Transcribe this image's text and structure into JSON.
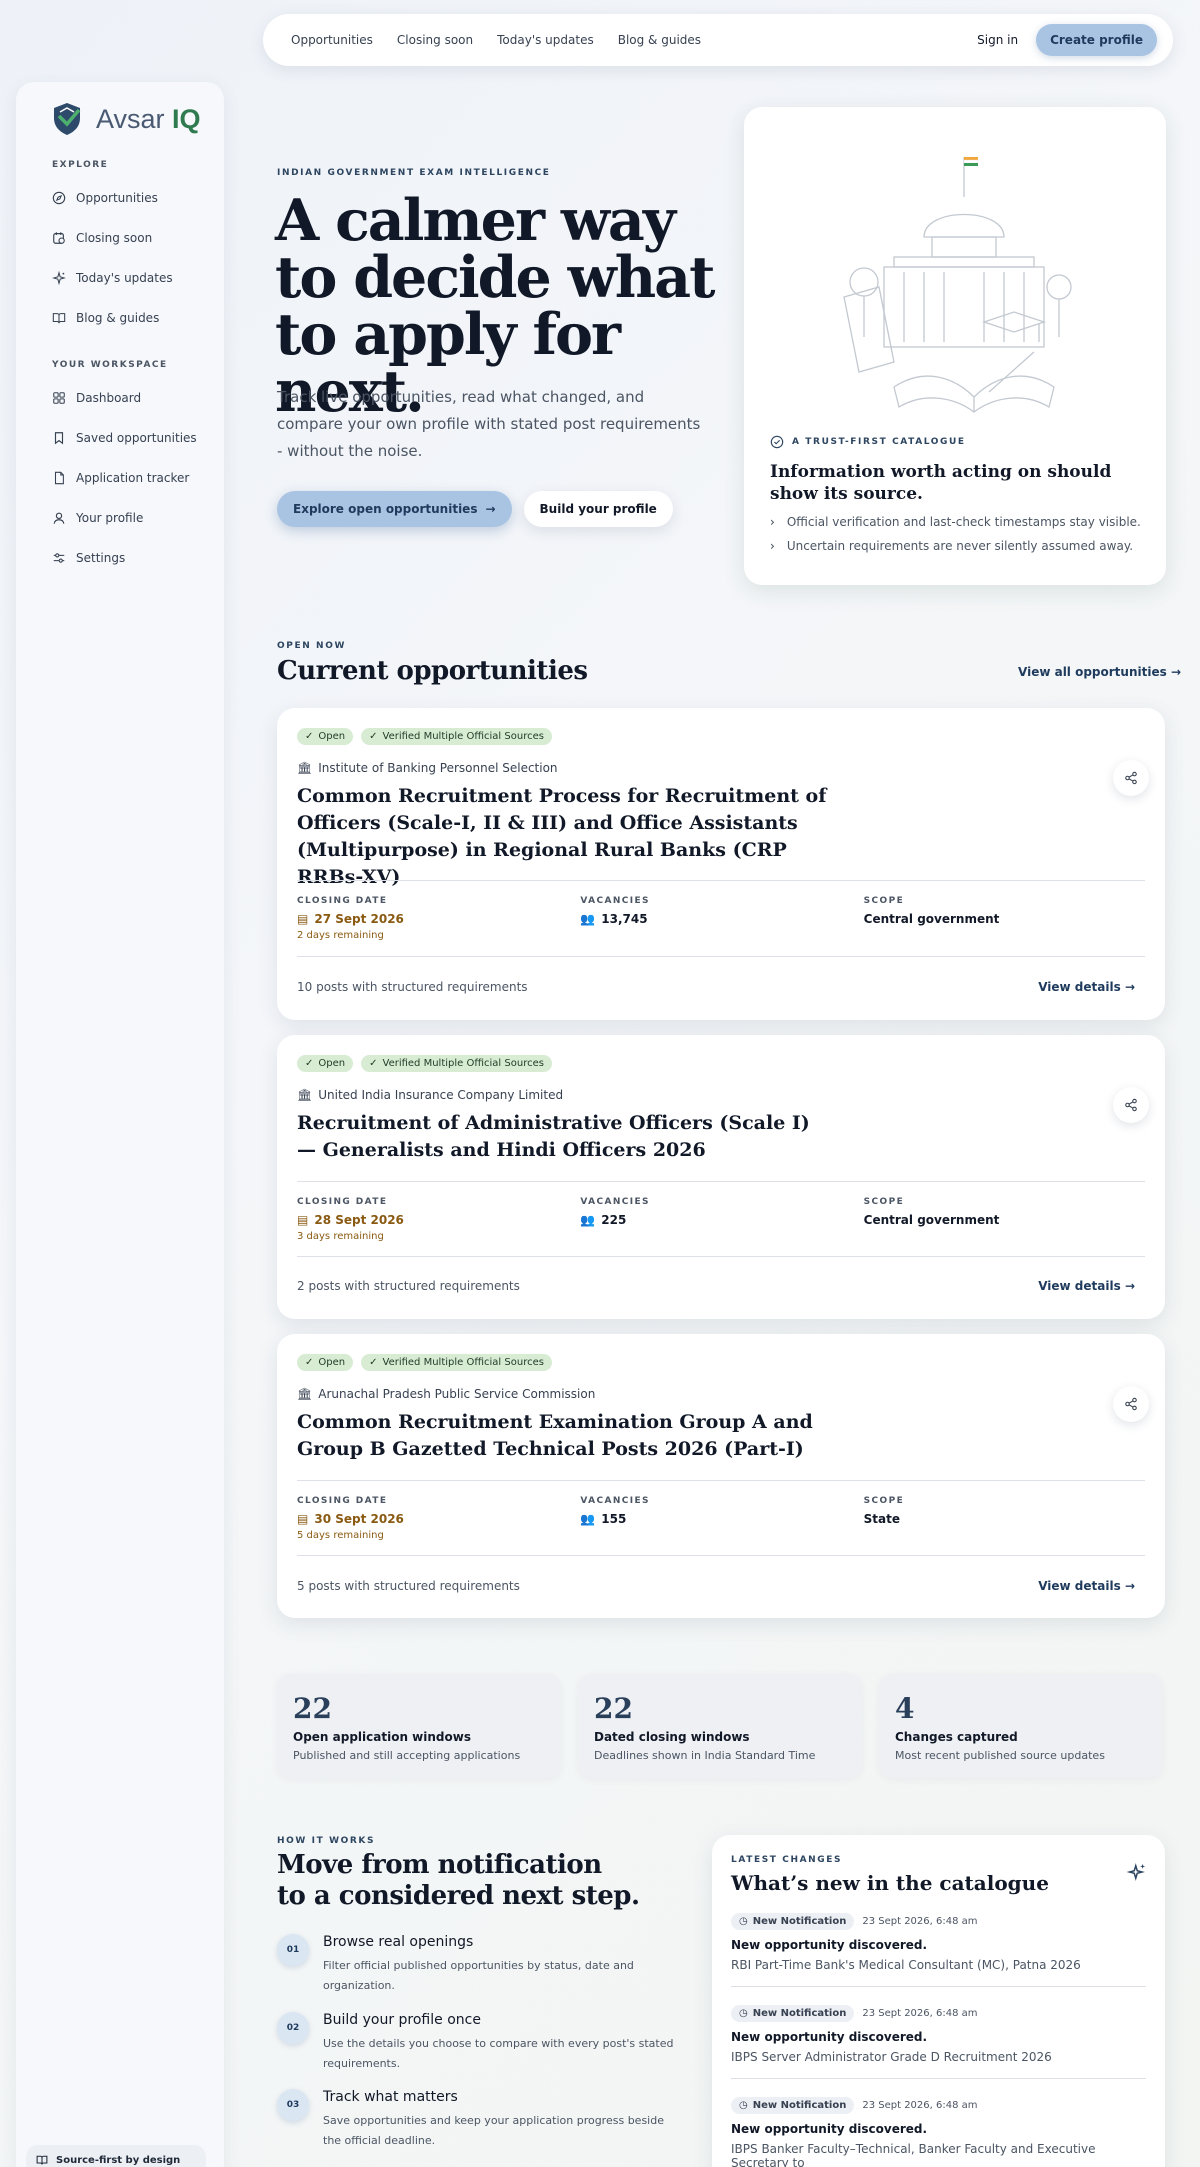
{
  "topnav": {
    "links": [
      "Opportunities",
      "Closing soon",
      "Today's updates",
      "Blog & guides"
    ],
    "sign_in": "Sign in",
    "create_profile": "Create profile"
  },
  "brand": {
    "name_main": "Avsar",
    "name_accent": "IQ"
  },
  "sidebar": {
    "explore_label": "EXPLORE",
    "explore": [
      {
        "label": "Opportunities",
        "icon": "compass-icon"
      },
      {
        "label": "Closing soon",
        "icon": "calendar-clock-icon"
      },
      {
        "label": "Today's updates",
        "icon": "sparkles-icon"
      },
      {
        "label": "Blog & guides",
        "icon": "book-icon"
      }
    ],
    "workspace_label": "YOUR WORKSPACE",
    "workspace": [
      {
        "label": "Dashboard",
        "icon": "grid-icon"
      },
      {
        "label": "Saved opportunities",
        "icon": "bookmark-icon"
      },
      {
        "label": "Application tracker",
        "icon": "document-icon"
      },
      {
        "label": "Your profile",
        "icon": "user-icon"
      },
      {
        "label": "Settings",
        "icon": "sliders-icon"
      }
    ],
    "footer": "Source-first by design"
  },
  "hero": {
    "eyebrow": "INDIAN GOVERNMENT EXAM INTELLIGENCE",
    "title": "A calmer way to decide what to apply for next.",
    "subtitle": "Track live opportunities, read what changed, and compare your own profile with stated post requirements - without the noise.",
    "primary_button": "Explore open opportunities",
    "secondary_button": "Build your profile"
  },
  "trust": {
    "tag": "A TRUST-FIRST CATALOGUE",
    "title": "Information worth acting on should show its source.",
    "points": [
      "Official verification and last-check timestamps stay visible.",
      "Uncertain requirements are never silently assumed away."
    ]
  },
  "current": {
    "eyebrow": "OPEN NOW",
    "title": "Current opportunities",
    "view_all": "View all opportunities"
  },
  "labels": {
    "closing_date": "CLOSING DATE",
    "vacancies": "VACANCIES",
    "scope": "SCOPE",
    "view_details": "View details"
  },
  "opportunities": [
    {
      "status": "Open",
      "verification": "Verified Multiple Official Sources",
      "org": "Institute of Banking Personnel Selection",
      "title": "Common Recruitment Process for Recruitment of Officers (Scale-I, II & III) and Office Assistants (Multipurpose) in Regional Rural Banks (CRP RRBs-XV)",
      "closing_date": "27 Sept 2026",
      "remaining": "2 days remaining",
      "vacancies": "13,745",
      "scope": "Central government",
      "posts": "10 posts with structured requirements"
    },
    {
      "status": "Open",
      "verification": "Verified Multiple Official Sources",
      "org": "United India Insurance Company Limited",
      "title": "Recruitment of Administrative Officers (Scale I) — Generalists and Hindi Officers 2026",
      "closing_date": "28 Sept 2026",
      "remaining": "3 days remaining",
      "vacancies": "225",
      "scope": "Central government",
      "posts": "2 posts with structured requirements"
    },
    {
      "status": "Open",
      "verification": "Verified Multiple Official Sources",
      "org": "Arunachal Pradesh Public Service Commission",
      "title": "Common Recruitment Examination Group A and Group B Gazetted Technical Posts 2026 (Part-I)",
      "closing_date": "30 Sept 2026",
      "remaining": "5 days remaining",
      "vacancies": "155",
      "scope": "State",
      "posts": "5 posts with structured requirements"
    }
  ],
  "stats": [
    {
      "num": "22",
      "label": "Open application windows",
      "desc": "Published and still accepting applications"
    },
    {
      "num": "22",
      "label": "Dated closing windows",
      "desc": "Deadlines shown in India Standard Time"
    },
    {
      "num": "4",
      "label": "Changes captured",
      "desc": "Most recent published source updates"
    }
  ],
  "how": {
    "eyebrow": "HOW IT WORKS",
    "title_line1": "Move from notification",
    "title_line2": "to a considered next step.",
    "steps": [
      {
        "num": "01",
        "title": "Browse real openings",
        "desc": "Filter official published opportunities by status, date and organization."
      },
      {
        "num": "02",
        "title": "Build your profile once",
        "desc": "Use the details you choose to compare with every post's stated requirements."
      },
      {
        "num": "03",
        "title": "Track what matters",
        "desc": "Save opportunities and keep your application progress beside the official deadline."
      }
    ]
  },
  "latest": {
    "eyebrow": "LATEST CHANGES",
    "title": "What’s new in the catalogue",
    "items": [
      {
        "chip": "New Notification",
        "time": "23 Sept 2026, 6:48 am",
        "title": "New opportunity discovered.",
        "desc": "RBI Part-Time Bank's Medical Consultant (MC), Patna 2026"
      },
      {
        "chip": "New Notification",
        "time": "23 Sept 2026, 6:48 am",
        "title": "New opportunity discovered.",
        "desc": "IBPS Server Administrator Grade D Recruitment 2026"
      },
      {
        "chip": "New Notification",
        "time": "23 Sept 2026, 6:48 am",
        "title": "New opportunity discovered.",
        "desc": "IBPS Banker Faculty–Technical, Banker Faculty and Executive Secretary to"
      }
    ]
  }
}
